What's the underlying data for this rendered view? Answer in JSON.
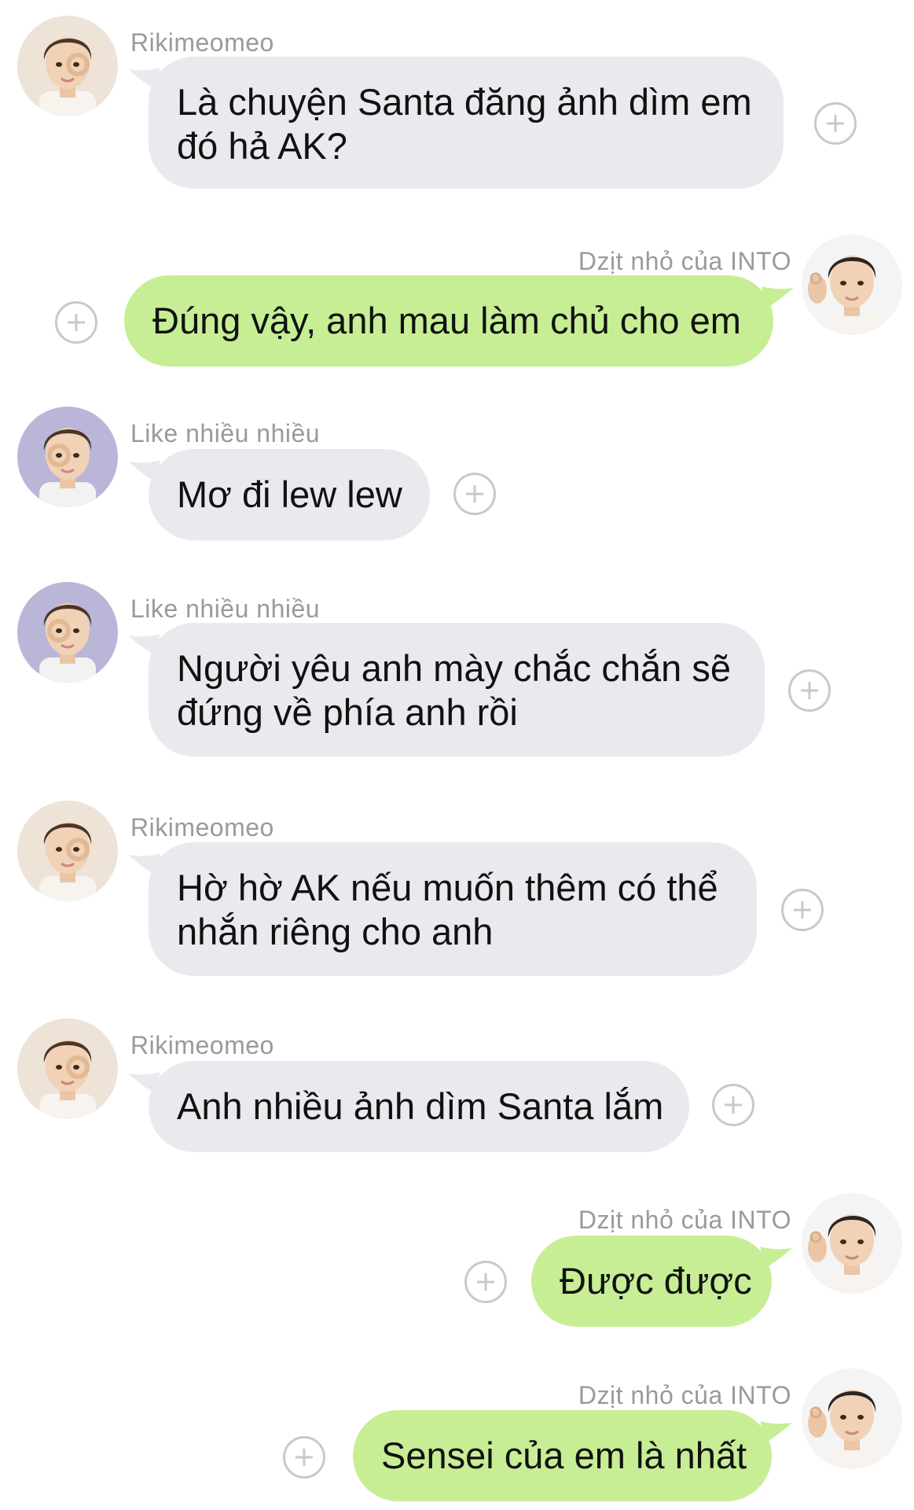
{
  "colors": {
    "incoming_bubble": "#e8eaee",
    "outgoing_bubble": "#c7ee95",
    "sender_name": "#9a9a9a",
    "text": "#111111",
    "reaction_icon": "#c9c9c9"
  },
  "messages": [
    {
      "direction": "in",
      "sender": "Rikimeomeo",
      "avatar": "avatar-rikimeomeo",
      "lines": [
        "Là chuyện Santa đăng ảnh dìm em",
        "đó hả AK?"
      ]
    },
    {
      "direction": "out",
      "sender": "Dzịt nhỏ của INTO",
      "avatar": "avatar-dzit-nho",
      "lines": [
        "Đúng vậy, anh mau làm chủ cho em"
      ]
    },
    {
      "direction": "in",
      "sender": "Like nhiều nhiều",
      "avatar": "avatar-like-nhieu",
      "lines": [
        "Mơ đi lew lew"
      ]
    },
    {
      "direction": "in",
      "sender": "Like nhiều nhiều",
      "avatar": "avatar-like-nhieu",
      "lines": [
        "Người yêu anh mày chắc chắn sẽ",
        "đứng về phía anh rồi"
      ]
    },
    {
      "direction": "in",
      "sender": "Rikimeomeo",
      "avatar": "avatar-rikimeomeo",
      "lines": [
        "Hờ hờ AK nếu muốn thêm có thể",
        "nhắn riêng cho anh"
      ]
    },
    {
      "direction": "in",
      "sender": "Rikimeomeo",
      "avatar": "avatar-rikimeomeo",
      "lines": [
        "Anh nhiều ảnh dìm Santa lắm"
      ]
    },
    {
      "direction": "out",
      "sender": "Dzịt nhỏ của INTO",
      "avatar": "avatar-dzit-nho",
      "lines": [
        "Được được"
      ]
    },
    {
      "direction": "out",
      "sender": "Dzịt nhỏ của INTO",
      "avatar": "avatar-dzit-nho",
      "lines": [
        "Sensei của em là nhất"
      ]
    }
  ]
}
